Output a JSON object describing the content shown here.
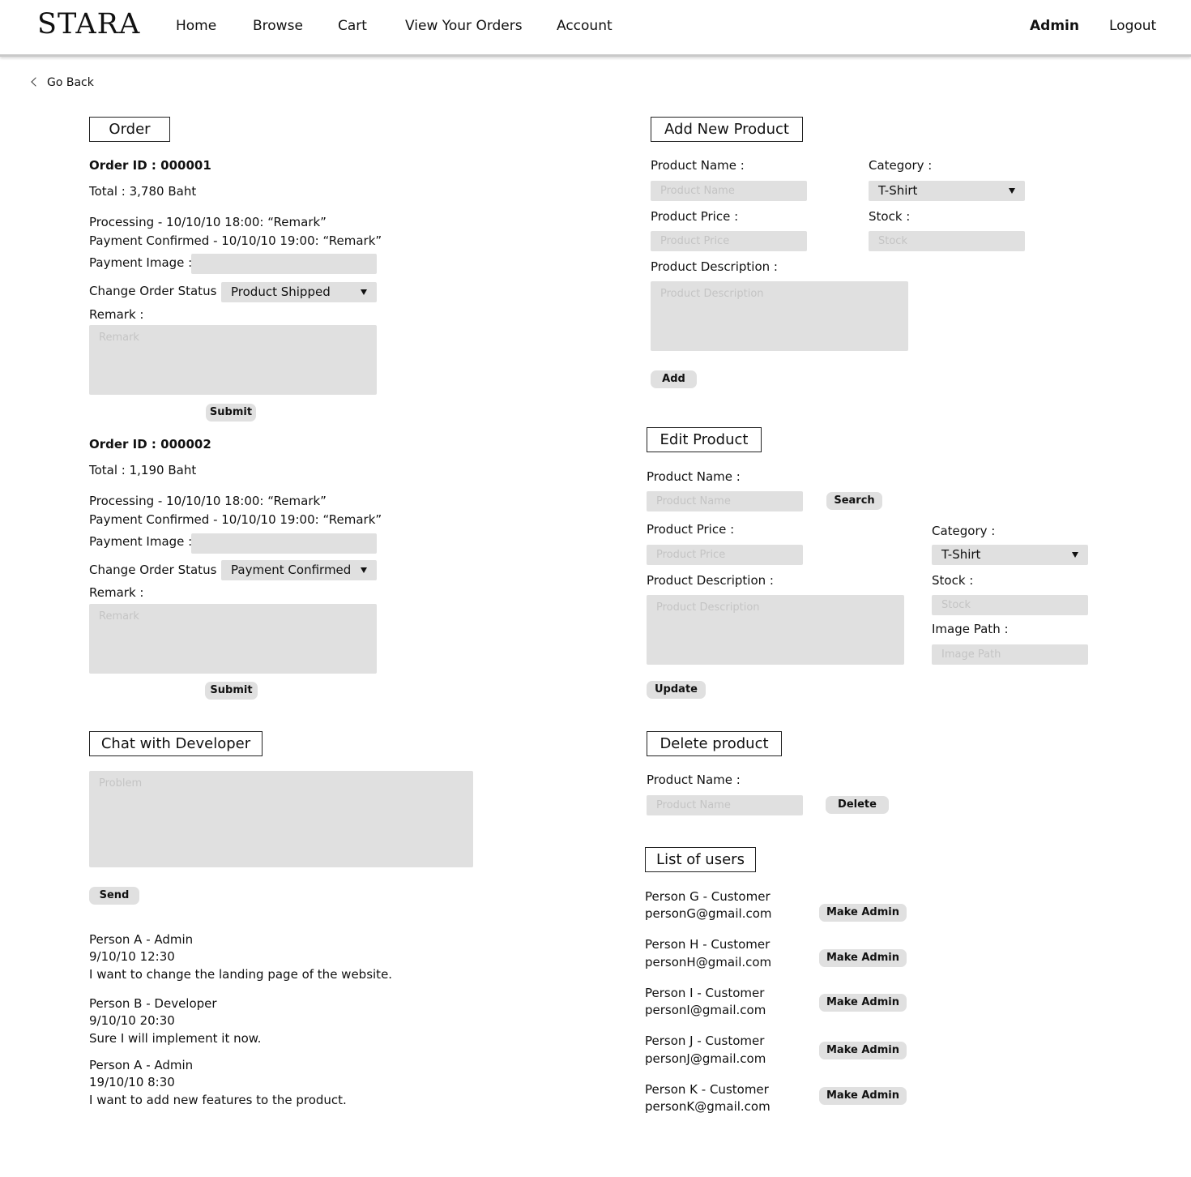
{
  "header": {
    "logo": "STARA",
    "nav": [
      "Home",
      "Browse",
      "Cart",
      "View Your Orders",
      "Account"
    ],
    "admin": "Admin",
    "logout": "Logout"
  },
  "go_back": "Go Back",
  "order_section": {
    "title": "Order",
    "orders": [
      {
        "id_label": "Order ID : 000001",
        "total": "Total  : 3,780 Baht",
        "history": [
          "Processing - 10/10/10 18:00: “Remark”",
          "Payment Confirmed - 10/10/10 19:00: “Remark”"
        ],
        "payment_image_label": "Payment Image :",
        "status_label": "Change Order Status :",
        "status_value": "Product Shipped",
        "remark_label": "Remark :",
        "remark_placeholder": "Remark",
        "submit": "Submit"
      },
      {
        "id_label": "Order ID : 000002",
        "total": "Total  : 1,190 Baht",
        "history": [
          "Processing - 10/10/10 18:00: “Remark”",
          "Payment Confirmed - 10/10/10 19:00: “Remark”"
        ],
        "payment_image_label": "Payment Image :",
        "status_label": "Change Order Status :",
        "status_value": "Payment Confirmed",
        "remark_label": "Remark :",
        "remark_placeholder": "Remark",
        "submit": "Submit"
      }
    ]
  },
  "chat": {
    "title": "Chat with Developer",
    "placeholder": "Problem",
    "send": "Send",
    "messages": [
      {
        "author": "Person A - Admin",
        "time": "9/10/10 12:30",
        "text": "I want to change the landing page of the website."
      },
      {
        "author": "Person B - Developer",
        "time": "9/10/10 20:30",
        "text": "Sure I will implement it now."
      },
      {
        "author": "Person A - Admin",
        "time": "19/10/10 8:30",
        "text": "I want to add new features to the product."
      }
    ]
  },
  "add_product": {
    "title": "Add New Product",
    "name_label": "Product Name :",
    "name_placeholder": "Product Name",
    "category_label": "Category :",
    "category_value": "T-Shirt",
    "price_label": "Product Price :",
    "price_placeholder": "Product Price",
    "stock_label": "Stock :",
    "stock_placeholder": "Stock",
    "desc_label": "Product Description :",
    "desc_placeholder": "Product Description",
    "add": "Add"
  },
  "edit_product": {
    "title": "Edit Product",
    "name_label": "Product Name :",
    "name_placeholder": "Product Name",
    "search": "Search",
    "price_label": "Product Price :",
    "price_placeholder": "Product Price",
    "category_label": "Category :",
    "category_value": "T-Shirt",
    "desc_label": "Product Description :",
    "desc_placeholder": "Product Description",
    "stock_label": "Stock :",
    "stock_placeholder": "Stock",
    "image_label": "Image Path :",
    "image_placeholder": "Image Path",
    "update": "Update"
  },
  "delete_product": {
    "title": "Delete product",
    "name_label": "Product Name :",
    "name_placeholder": "Product Name",
    "delete": "Delete"
  },
  "users": {
    "title": "List of users",
    "button": "Make Admin",
    "list": [
      {
        "name": "Person G - Customer",
        "email": "personG@gmail.com"
      },
      {
        "name": "Person H - Customer",
        "email": "personH@gmail.com"
      },
      {
        "name": "Person I - Customer",
        "email": "personI@gmail.com"
      },
      {
        "name": "Person J - Customer",
        "email": "personJ@gmail.com"
      },
      {
        "name": "Person K - Customer",
        "email": "personK@gmail.com"
      }
    ]
  }
}
